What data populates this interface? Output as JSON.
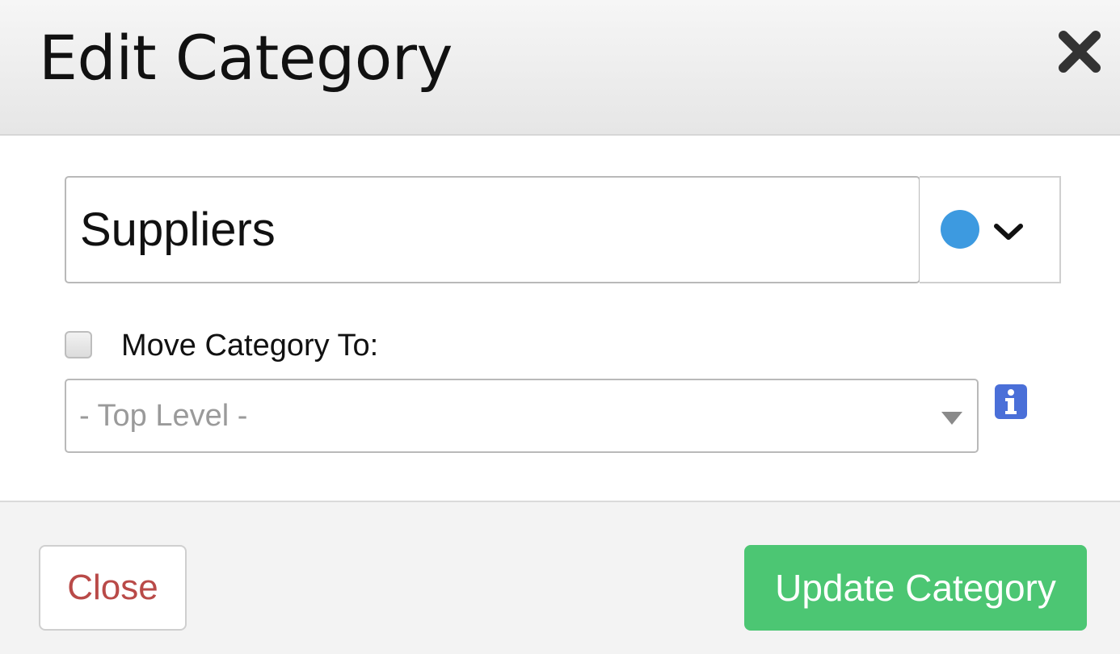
{
  "header": {
    "title": "Edit Category",
    "close_icon": "close-x-icon"
  },
  "form": {
    "category_name": "Suppliers",
    "color_picker": {
      "selected_color": "#3d9ae0",
      "chevron_icon": "chevron-down-icon"
    },
    "move_checkbox": {
      "checked": false,
      "label": "Move Category To:"
    },
    "level_select": {
      "selected": "- Top Level -",
      "caret_icon": "caret-down-icon"
    },
    "info_icon": "info-icon",
    "info_icon_color": "#4a6fd8"
  },
  "footer": {
    "close_label": "Close",
    "close_color": "#b94a48",
    "update_label": "Update Category",
    "update_color": "#4cc673"
  }
}
